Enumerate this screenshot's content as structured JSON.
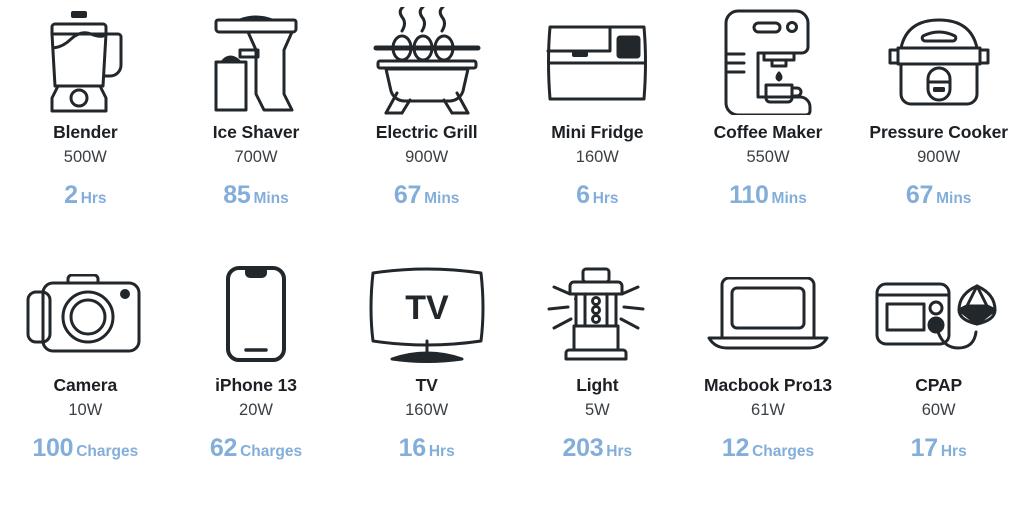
{
  "theme": {
    "background": "#ffffff",
    "name_color": "#1c2024",
    "watt_color": "#3b4045",
    "accent_color": "#84aeda",
    "icon_stroke": "#22272b"
  },
  "appliances": [
    {
      "icon": "blender-icon",
      "name": "Blender",
      "power": "500W",
      "runtime_value": "2",
      "runtime_unit": "Hrs"
    },
    {
      "icon": "ice-shaver-icon",
      "name": "Ice Shaver",
      "power": "700W",
      "runtime_value": "85",
      "runtime_unit": "Mins"
    },
    {
      "icon": "electric-grill-icon",
      "name": "Electric Grill",
      "power": "900W",
      "runtime_value": "67",
      "runtime_unit": "Mins"
    },
    {
      "icon": "mini-fridge-icon",
      "name": "Mini Fridge",
      "power": "160W",
      "runtime_value": "6",
      "runtime_unit": "Hrs"
    },
    {
      "icon": "coffee-maker-icon",
      "name": "Coffee Maker",
      "power": "550W",
      "runtime_value": "110",
      "runtime_unit": "Mins"
    },
    {
      "icon": "pressure-cooker-icon",
      "name": "Pressure Cooker",
      "power": "900W",
      "runtime_value": "67",
      "runtime_unit": "Mins"
    },
    {
      "icon": "camera-icon",
      "name": "Camera",
      "power": "10W",
      "runtime_value": "100",
      "runtime_unit": "Charges"
    },
    {
      "icon": "iphone-icon",
      "name": "iPhone 13",
      "power": "20W",
      "runtime_value": "62",
      "runtime_unit": "Charges"
    },
    {
      "icon": "tv-icon",
      "name": "TV",
      "power": "160W",
      "runtime_value": "16",
      "runtime_unit": "Hrs"
    },
    {
      "icon": "light-icon",
      "name": "Light",
      "power": "5W",
      "runtime_value": "203",
      "runtime_unit": "Hrs"
    },
    {
      "icon": "laptop-icon",
      "name": "Macbook Pro13",
      "power": "61W",
      "runtime_value": "12",
      "runtime_unit": "Charges"
    },
    {
      "icon": "cpap-icon",
      "name": "CPAP",
      "power": "60W",
      "runtime_value": "17",
      "runtime_unit": "Hrs"
    }
  ],
  "tv_screen_label": "TV"
}
